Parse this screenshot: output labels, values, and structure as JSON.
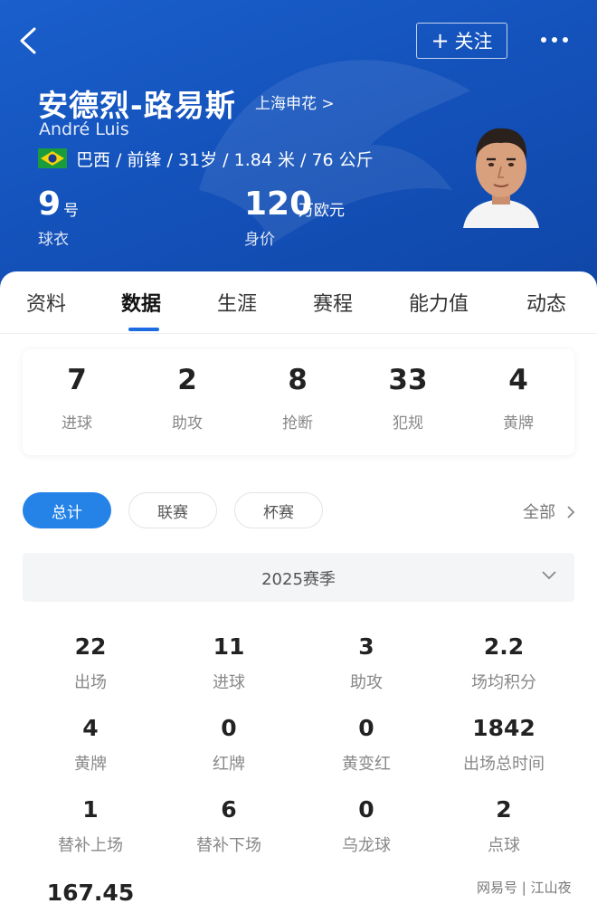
{
  "header": {
    "follow_label": "关注",
    "name_cn": "安德烈-路易斯",
    "club": "上海申花 >",
    "name_en": "André Luis",
    "info": "巴西 / 前锋 / 31岁 / 1.84 米 / 76 公斤",
    "shirt_number": "9",
    "shirt_unit": "号",
    "shirt_label": "球衣",
    "value": "120",
    "value_unit": "万欧元",
    "value_label": "身价"
  },
  "tabs": [
    {
      "label": "资料"
    },
    {
      "label": "数据"
    },
    {
      "label": "生涯"
    },
    {
      "label": "赛程"
    },
    {
      "label": "能力值"
    },
    {
      "label": "动态"
    }
  ],
  "summary": [
    {
      "value": "7",
      "label": "进球"
    },
    {
      "value": "2",
      "label": "助攻"
    },
    {
      "value": "8",
      "label": "抢断"
    },
    {
      "value": "33",
      "label": "犯规"
    },
    {
      "value": "4",
      "label": "黄牌"
    }
  ],
  "filters": [
    {
      "label": "总计"
    },
    {
      "label": "联赛"
    },
    {
      "label": "杯赛"
    }
  ],
  "all_label": "全部",
  "season_label": "2025赛季",
  "stats": [
    {
      "value": "22",
      "label": "出场"
    },
    {
      "value": "11",
      "label": "进球"
    },
    {
      "value": "3",
      "label": "助攻"
    },
    {
      "value": "2.2",
      "label": "场均积分"
    },
    {
      "value": "4",
      "label": "黄牌"
    },
    {
      "value": "0",
      "label": "红牌"
    },
    {
      "value": "0",
      "label": "黄变红"
    },
    {
      "value": "1842",
      "label": "出场总时间"
    },
    {
      "value": "1",
      "label": "替补上场"
    },
    {
      "value": "6",
      "label": "替补下场"
    },
    {
      "value": "0",
      "label": "乌龙球"
    },
    {
      "value": "2",
      "label": "点球"
    },
    {
      "value": "167.45",
      "label": ""
    }
  ],
  "watermark": "网易号 | 江山夜",
  "colors": {
    "header_blue": "#1759c4",
    "accent": "#2583e8"
  }
}
